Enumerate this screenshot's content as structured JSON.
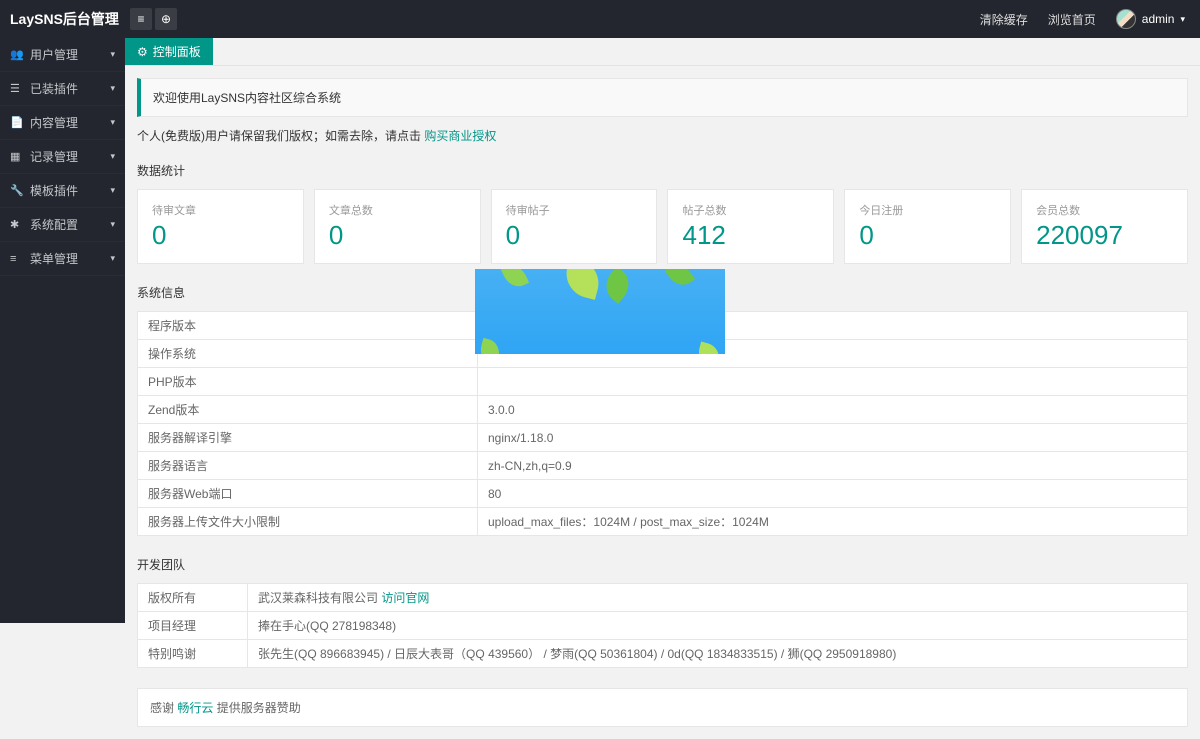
{
  "header": {
    "logo": "LaySNS后台管理",
    "clear_cache": "清除缓存",
    "view_home": "浏览首页",
    "username": "admin"
  },
  "sidebar": {
    "items": [
      {
        "icon": "👥",
        "label": "用户管理"
      },
      {
        "icon": "☰",
        "label": "已装插件"
      },
      {
        "icon": "📄",
        "label": "内容管理"
      },
      {
        "icon": "▦",
        "label": "记录管理"
      },
      {
        "icon": "🔧",
        "label": "模板插件"
      },
      {
        "icon": "✱",
        "label": "系统配置"
      },
      {
        "icon": "≡",
        "label": "菜单管理"
      }
    ]
  },
  "tab": {
    "label": "控制面板"
  },
  "welcome": "欢迎使用LaySNS内容社区综合系统",
  "note": {
    "text": "个人(免费版)用户请保留我们版权；如需去除，请点击 ",
    "link": "购买商业授权"
  },
  "stats": {
    "title": "数据统计",
    "items": [
      {
        "label": "待审文章",
        "value": "0"
      },
      {
        "label": "文章总数",
        "value": "0"
      },
      {
        "label": "待审帖子",
        "value": "0"
      },
      {
        "label": "帖子总数",
        "value": "412"
      },
      {
        "label": "今日注册",
        "value": "0"
      },
      {
        "label": "会员总数",
        "value": "220097"
      }
    ]
  },
  "sysinfo": {
    "title": "系统信息",
    "rows": [
      {
        "k": "程序版本",
        "v": ""
      },
      {
        "k": "操作系统",
        "v": ""
      },
      {
        "k": "PHP版本",
        "v": ""
      },
      {
        "k": "Zend版本",
        "v": "3.0.0"
      },
      {
        "k": "服务器解译引擎",
        "v": "nginx/1.18.0"
      },
      {
        "k": "服务器语言",
        "v": "zh-CN,zh,q=0.9"
      },
      {
        "k": "服务器Web端口",
        "v": "80"
      },
      {
        "k": "服务器上传文件大小限制",
        "v": "upload_max_files：1024M / post_max_size：1024M"
      }
    ]
  },
  "team": {
    "title": "开发团队",
    "rows": [
      {
        "k": "版权所有",
        "v": "武汉莱森科技有限公司 ",
        "link": "访问官网"
      },
      {
        "k": "项目经理",
        "v": "捧在手心(QQ 278198348)"
      },
      {
        "k": "特别鸣谢",
        "v": "张先生(QQ 896683945) / 日辰大表哥（QQ 439560） / 梦雨(QQ 50361804) / 0d(QQ 1834833515) / 狮(QQ 2950918980)"
      }
    ]
  },
  "thanks": {
    "pre": "感谢 ",
    "link": "畅行云",
    "post": " 提供服务器赞助"
  }
}
